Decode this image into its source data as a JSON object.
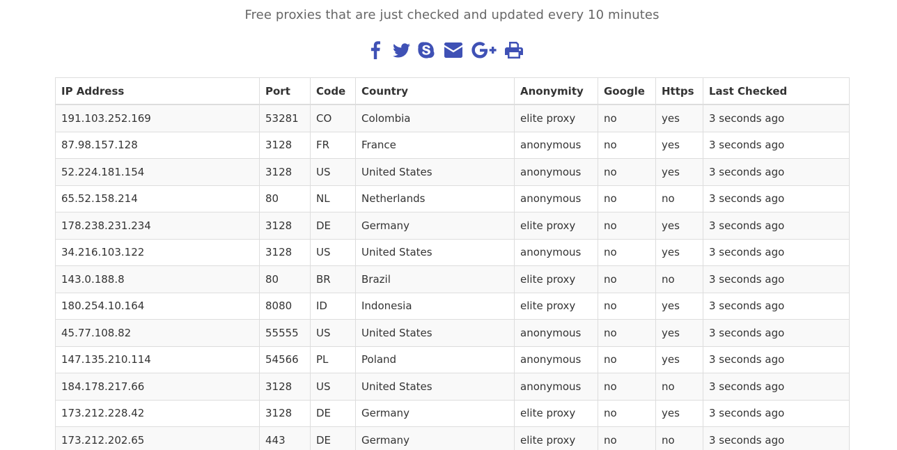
{
  "header": {
    "subtitle": "Free proxies that are just checked and updated every 10 minutes"
  },
  "share": {
    "icon_color": "#3f51b5",
    "icons": [
      "facebook-icon",
      "twitter-icon",
      "skype-icon",
      "envelope-icon",
      "google-plus-icon",
      "print-icon"
    ]
  },
  "table": {
    "headers": {
      "ip": "IP Address",
      "port": "Port",
      "code": "Code",
      "country": "Country",
      "anonymity": "Anonymity",
      "google": "Google",
      "https": "Https",
      "last_checked": "Last Checked"
    },
    "rows": [
      {
        "ip": "191.103.252.169",
        "port": "53281",
        "code": "CO",
        "country": "Colombia",
        "anonymity": "elite proxy",
        "google": "no",
        "https": "yes",
        "last_checked": "3 seconds ago"
      },
      {
        "ip": "87.98.157.128",
        "port": "3128",
        "code": "FR",
        "country": "France",
        "anonymity": "anonymous",
        "google": "no",
        "https": "yes",
        "last_checked": "3 seconds ago"
      },
      {
        "ip": "52.224.181.154",
        "port": "3128",
        "code": "US",
        "country": "United States",
        "anonymity": "anonymous",
        "google": "no",
        "https": "yes",
        "last_checked": "3 seconds ago"
      },
      {
        "ip": "65.52.158.214",
        "port": "80",
        "code": "NL",
        "country": "Netherlands",
        "anonymity": "anonymous",
        "google": "no",
        "https": "no",
        "last_checked": "3 seconds ago"
      },
      {
        "ip": "178.238.231.234",
        "port": "3128",
        "code": "DE",
        "country": "Germany",
        "anonymity": "elite proxy",
        "google": "no",
        "https": "yes",
        "last_checked": "3 seconds ago"
      },
      {
        "ip": "34.216.103.122",
        "port": "3128",
        "code": "US",
        "country": "United States",
        "anonymity": "anonymous",
        "google": "no",
        "https": "yes",
        "last_checked": "3 seconds ago"
      },
      {
        "ip": "143.0.188.8",
        "port": "80",
        "code": "BR",
        "country": "Brazil",
        "anonymity": "elite proxy",
        "google": "no",
        "https": "no",
        "last_checked": "3 seconds ago"
      },
      {
        "ip": "180.254.10.164",
        "port": "8080",
        "code": "ID",
        "country": "Indonesia",
        "anonymity": "elite proxy",
        "google": "no",
        "https": "yes",
        "last_checked": "3 seconds ago"
      },
      {
        "ip": "45.77.108.82",
        "port": "55555",
        "code": "US",
        "country": "United States",
        "anonymity": "anonymous",
        "google": "no",
        "https": "yes",
        "last_checked": "3 seconds ago"
      },
      {
        "ip": "147.135.210.114",
        "port": "54566",
        "code": "PL",
        "country": "Poland",
        "anonymity": "anonymous",
        "google": "no",
        "https": "yes",
        "last_checked": "3 seconds ago"
      },
      {
        "ip": "184.178.217.66",
        "port": "3128",
        "code": "US",
        "country": "United States",
        "anonymity": "anonymous",
        "google": "no",
        "https": "no",
        "last_checked": "3 seconds ago"
      },
      {
        "ip": "173.212.228.42",
        "port": "3128",
        "code": "DE",
        "country": "Germany",
        "anonymity": "elite proxy",
        "google": "no",
        "https": "yes",
        "last_checked": "3 seconds ago"
      },
      {
        "ip": "173.212.202.65",
        "port": "443",
        "code": "DE",
        "country": "Germany",
        "anonymity": "elite proxy",
        "google": "no",
        "https": "no",
        "last_checked": "3 seconds ago"
      }
    ]
  }
}
